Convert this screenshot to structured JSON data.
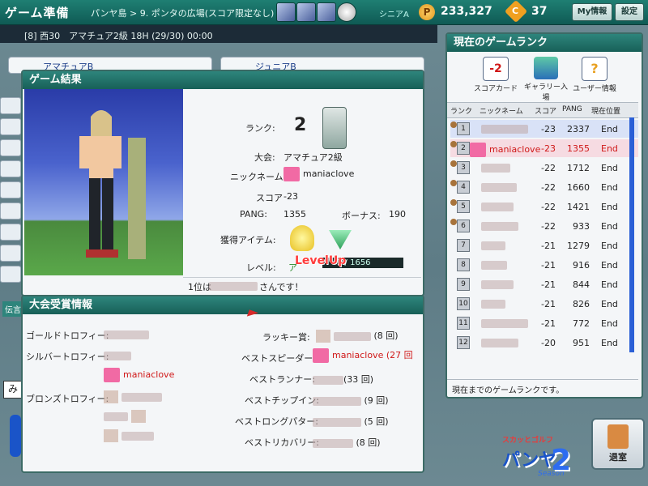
{
  "topbar": {
    "title": "ゲーム準備",
    "breadcrumb": "パンヤ島 > 9. ポンタの広場(スコア限定なし)",
    "server": "シニアA",
    "pang": "233,327",
    "cookie_icon_letter": "C",
    "cookies": "37",
    "coin_letter": "P",
    "my_info_label": "My情報",
    "settings_label": "設定"
  },
  "subbar": {
    "info": "[8] 西30　アマチュア2級 18H (29/30) 00:00"
  },
  "background_lists": {
    "left_tag": "アマチュアB",
    "right_tag": "ジュニアB",
    "side_tag": "伝言"
  },
  "game_result": {
    "header": "ゲーム結果",
    "rank_label": "ランク:",
    "rank_value": "2",
    "tournament_label": "大会:",
    "tournament_value": "アマチュア2級",
    "nickname_label": "ニックネーム:",
    "nickname_value": "maniaclove",
    "score_label": "スコア",
    "score_value": "-23",
    "pang_label": "PANG:",
    "pang_value": "1355",
    "bonus_label": "ボーナス:",
    "bonus_value": "190",
    "items_label": "獲得アイテム:",
    "level_label": "レベル:",
    "level_prefix": "ア",
    "level_up_text": "LevelUp",
    "level_exp": "3 / 1656",
    "first_place_prefix": "1位は",
    "first_place_suffix": "さんです！"
  },
  "awards": {
    "header": "大会受賞情報",
    "gold_label": "ゴールドトロフィー:",
    "silver_label": "シルバートロフィー:",
    "silver_name": "maniaclove",
    "bronze_label": "ブロンズトロフィー:",
    "lucky_label": "ラッキー賞:",
    "lucky_count": "(8 回)",
    "best_speeder_label": "ベストスピーダー:",
    "best_speeder_name": "maniaclove",
    "best_speeder_count": "(27 回",
    "best_runner_label": "ベストランナー:",
    "best_runner_count": "(33 回)",
    "best_chipin_label": "ベストチップイン:",
    "best_chipin_count": "(9 回)",
    "best_longputter_label": "ベストロングパター:",
    "best_longputter_count": "(5 回)",
    "best_recovery_label": "ベストリカバリー:",
    "best_recovery_count": "(8 回)"
  },
  "ranking": {
    "header": "現在のゲームランク",
    "scorecard_icon_value": "-2",
    "tools": [
      "スコアカード",
      "ギャラリー入場",
      "ユーザー情報"
    ],
    "columns": [
      "ランク",
      "ニックネーム",
      "スコア",
      "PANG",
      "現在位置"
    ],
    "rows": [
      {
        "rank": "1",
        "name": "",
        "score": "-23",
        "pang": "2337",
        "pos": "End"
      },
      {
        "rank": "2",
        "name": "maniaclove",
        "score": "-23",
        "pang": "1355",
        "pos": "End"
      },
      {
        "rank": "3",
        "name": "",
        "score": "-22",
        "pang": "1712",
        "pos": "End"
      },
      {
        "rank": "4",
        "name": "",
        "score": "-22",
        "pang": "1660",
        "pos": "End"
      },
      {
        "rank": "5",
        "name": "",
        "score": "-22",
        "pang": "1421",
        "pos": "End"
      },
      {
        "rank": "6",
        "name": "",
        "score": "-22",
        "pang": "933",
        "pos": "End"
      },
      {
        "rank": "7",
        "name": "",
        "score": "-21",
        "pang": "1279",
        "pos": "End"
      },
      {
        "rank": "8",
        "name": "",
        "score": "-21",
        "pang": "916",
        "pos": "End"
      },
      {
        "rank": "9",
        "name": "",
        "score": "-21",
        "pang": "844",
        "pos": "End"
      },
      {
        "rank": "10",
        "name": "",
        "score": "-21",
        "pang": "826",
        "pos": "End"
      },
      {
        "rank": "11",
        "name": "",
        "score": "-21",
        "pang": "772",
        "pos": "End"
      },
      {
        "rank": "12",
        "name": "",
        "score": "-20",
        "pang": "951",
        "pos": "End"
      }
    ],
    "footer": "現在までのゲームランクです。"
  },
  "exit_label": "退室",
  "logo": {
    "main": "パンヤ",
    "number": "2",
    "season": "Season",
    "small": "スカッとゴルフ"
  },
  "misc": {
    "chat_letter": "み"
  }
}
